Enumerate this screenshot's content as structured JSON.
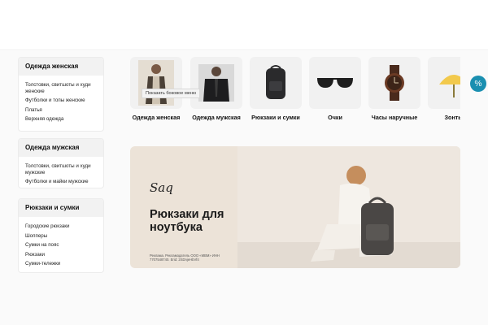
{
  "sidebar": {
    "groups": [
      {
        "title": "Одежда женская",
        "links": [
          "Толстовки, свитшоты и худи женские",
          "Футболки и топы женские",
          "Платья",
          "Верхняя одежда"
        ]
      },
      {
        "title": "Одежда мужская",
        "links": [
          "Толстовки, свитшоты и худи мужские",
          "Футболки и майки мужские"
        ]
      },
      {
        "title": "Рюкзаки и сумки",
        "links": [
          "Городские рюкзаки",
          "Шопперы",
          "Сумки на пояс",
          "Рюкзаки",
          "Сумки-тележки"
        ]
      }
    ]
  },
  "categories": [
    {
      "label": "Одежда женская",
      "icon": "woman-clothing-image"
    },
    {
      "label": "Одежда мужская",
      "icon": "man-clothing-image"
    },
    {
      "label": "Рюкзаки и сумки",
      "icon": "backpack-image"
    },
    {
      "label": "Очки",
      "icon": "sunglasses-image"
    },
    {
      "label": "Часы наручные",
      "icon": "wristwatch-image"
    },
    {
      "label": "Зонты",
      "icon": "umbrella-image"
    }
  ],
  "tooltip": {
    "text": "Показать боковое меню"
  },
  "banner": {
    "logo": "Saq",
    "headline": "Рюкзаки для ноутбука",
    "legal": "Реклама. Рекламодатель ООО «МВМ» ИНН 7707548740. Erid: 2SDnjeHbVf4"
  },
  "colors": {
    "accent": "#1a8fb0",
    "tile_bg": "#f1f1f1"
  }
}
